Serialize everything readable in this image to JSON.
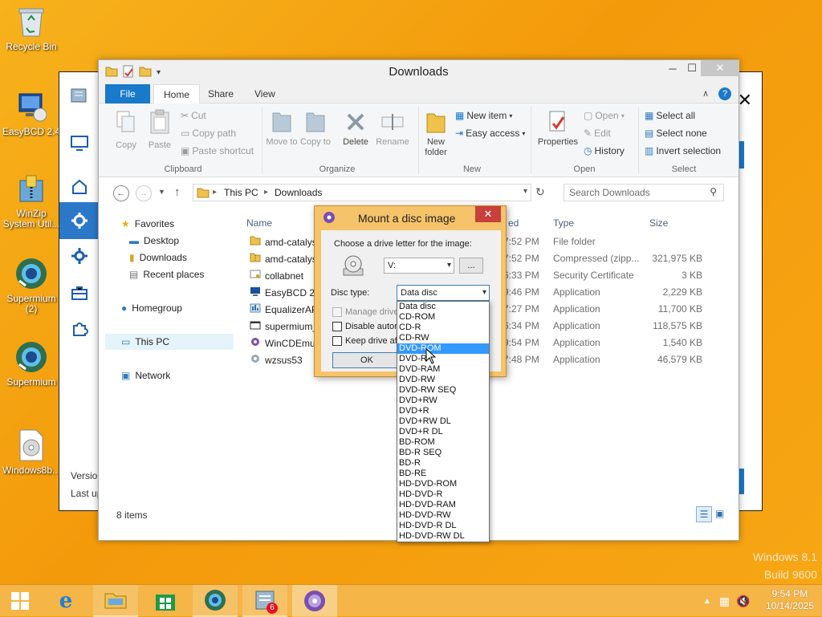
{
  "desktop": {
    "icons": [
      {
        "label": "Recycle Bin",
        "icon": "recycle-bin-icon"
      },
      {
        "label": "EasyBCD 2.4",
        "icon": "easybcd-icon"
      },
      {
        "label": "WinZip System Util...",
        "icon": "winzip-icon"
      },
      {
        "label": "Supermium (2)",
        "icon": "supermium-icon"
      },
      {
        "label": "Supermium",
        "icon": "supermium-icon"
      },
      {
        "label": "Windows8b...",
        "icon": "disc-image-icon"
      }
    ],
    "watermark_line1": "Windows 8.1",
    "watermark_line2": "Build 9600"
  },
  "back_window": {
    "version_label": "Versio",
    "last_label": "Last up"
  },
  "explorer": {
    "title": "Downloads",
    "tabs": [
      "File",
      "Home",
      "Share",
      "View"
    ],
    "ribbon": {
      "clipboard": {
        "label": "Clipboard",
        "copy": "Copy",
        "paste": "Paste",
        "cut": "Cut",
        "copy_path": "Copy path",
        "paste_shortcut": "Paste shortcut"
      },
      "organize": {
        "label": "Organize",
        "move_to": "Move to",
        "copy_to": "Copy to",
        "delete": "Delete",
        "rename": "Rename"
      },
      "new": {
        "label": "New",
        "new_folder": "New folder",
        "new_item": "New item",
        "easy_access": "Easy access"
      },
      "open": {
        "label": "Open",
        "properties": "Properties",
        "open": "Open",
        "edit": "Edit",
        "history": "History"
      },
      "select": {
        "label": "Select",
        "select_all": "Select all",
        "select_none": "Select none",
        "invert": "Invert selection"
      }
    },
    "breadcrumb": [
      "This PC",
      "Downloads"
    ],
    "search_placeholder": "Search Downloads",
    "nav": {
      "favorites": "Favorites",
      "desktop": "Desktop",
      "downloads": "Downloads",
      "recent": "Recent places",
      "homegroup": "Homegroup",
      "this_pc": "This PC",
      "network": "Network"
    },
    "columns": {
      "name": "Name",
      "date": "ed",
      "type": "Type",
      "size": "Size"
    },
    "files": [
      {
        "name": "amd-catalys",
        "date": "7:52 PM",
        "type": "File folder",
        "size": ""
      },
      {
        "name": "amd-catalys",
        "date": "7:52 PM",
        "type": "Compressed (zipp...",
        "size": "321,975 KB"
      },
      {
        "name": "collabnet",
        "date": "6:33 PM",
        "type": "Security Certificate",
        "size": "3 KB"
      },
      {
        "name": "EasyBCD 2.4",
        "date": "9:46 PM",
        "type": "Application",
        "size": "2,229 KB"
      },
      {
        "name": "EqualizerAP",
        "date": "7:27 PM",
        "type": "Application",
        "size": "11,700 KB"
      },
      {
        "name": "supermium_",
        "date": "6:34 PM",
        "type": "Application",
        "size": "118,575 KB"
      },
      {
        "name": "WinCDEmu-",
        "date": "9:54 PM",
        "type": "Application",
        "size": "1,540 KB"
      },
      {
        "name": "wzsus53",
        "date": "7:48 PM",
        "type": "Application",
        "size": "46,579 KB"
      }
    ],
    "status": "8 items"
  },
  "dialog": {
    "title": "Mount a disc image",
    "drive_prompt": "Choose a drive letter for the image:",
    "drive_value": "V:",
    "browse_label": "...",
    "disc_type_label": "Disc type:",
    "disc_type_value": "Data disc",
    "manage_label": "Manage drive",
    "disable_label": "Disable autorun",
    "keep_label": "Keep drive af",
    "ok_label": "OK"
  },
  "dropdown": {
    "selected": "DVD-ROM",
    "options": [
      "Data disc",
      "CD-ROM",
      "CD-R",
      "CD-RW",
      "DVD-ROM",
      "DVD-R",
      "DVD-RAM",
      "DVD-RW",
      "DVD-RW SEQ",
      "DVD+RW",
      "DVD+R",
      "DVD+RW DL",
      "DVD+R DL",
      "BD-ROM",
      "BD-R SEQ",
      "BD-R",
      "BD-RE",
      "HD-DVD-ROM",
      "HD-DVD-R",
      "HD-DVD-RAM",
      "HD-DVD-RW",
      "HD-DVD-R DL",
      "HD-DVD-RW DL"
    ]
  },
  "taskbar": {
    "badge_count": "6",
    "time": "9:54 PM",
    "date": "10/14/2025"
  },
  "colors": {
    "accent": "#1979ca",
    "desktop": "#f5a20c",
    "selection": "#3399ff",
    "dialog_frame": "#f5c36a"
  }
}
